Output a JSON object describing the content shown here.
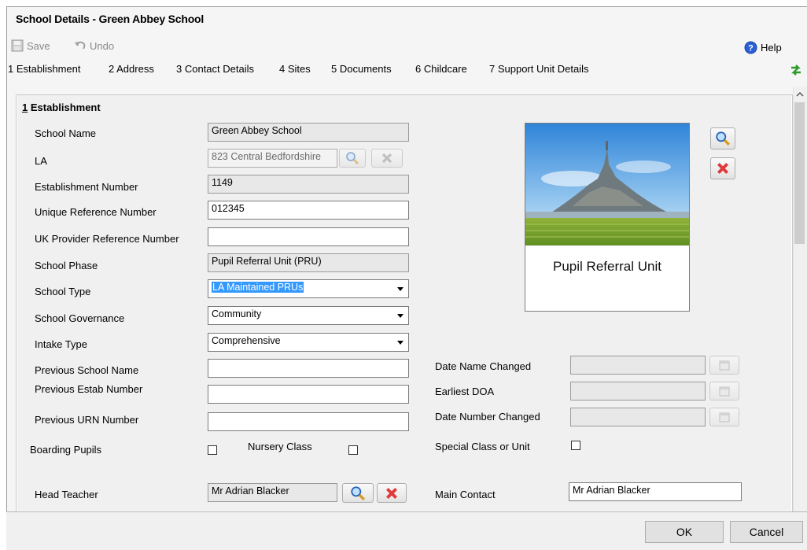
{
  "window": {
    "title": "School Details - Green Abbey School"
  },
  "toolbar": {
    "save_label": "Save",
    "undo_label": "Undo",
    "help_label": "Help"
  },
  "tabs": [
    {
      "label": "1 Establishment"
    },
    {
      "label": "2 Address"
    },
    {
      "label": "3 Contact Details"
    },
    {
      "label": "4 Sites"
    },
    {
      "label": "5 Documents"
    },
    {
      "label": "6 Childcare"
    },
    {
      "label": "7 Support Unit Details"
    }
  ],
  "section": {
    "title": "1 Establishment"
  },
  "fields": {
    "school_name": {
      "label": "School Name",
      "value": "Green Abbey School"
    },
    "la": {
      "label": "LA",
      "value": "823 Central Bedfordshire"
    },
    "establishment_number": {
      "label": "Establishment Number",
      "value": "1149"
    },
    "urn": {
      "label": "Unique Reference Number",
      "value": "012345"
    },
    "ukprn": {
      "label": "UK Provider Reference Number",
      "value": ""
    },
    "school_phase": {
      "label": "School Phase",
      "value": "Pupil Referral Unit (PRU)"
    },
    "school_type": {
      "label": "School Type",
      "value": "LA Maintained PRUs"
    },
    "school_governance": {
      "label": "School Governance",
      "value": "Community"
    },
    "intake_type": {
      "label": "Intake Type",
      "value": "Comprehensive"
    },
    "previous_school_name": {
      "label": "Previous School Name",
      "value": ""
    },
    "previous_estab_number": {
      "label": "Previous Estab Number",
      "value": ""
    },
    "previous_urn": {
      "label": "Previous URN Number",
      "value": ""
    },
    "date_name_changed": {
      "label": "Date Name Changed",
      "value": ""
    },
    "earliest_doa": {
      "label": "Earliest DOA",
      "value": ""
    },
    "date_number_changed": {
      "label": "Date Number Changed",
      "value": ""
    },
    "boarding_pupils": {
      "label": "Boarding Pupils",
      "checked": false
    },
    "nursery_class": {
      "label": "Nursery Class",
      "checked": false
    },
    "special_class": {
      "label": "Special Class or Unit",
      "checked": false
    },
    "head_teacher": {
      "label": "Head Teacher",
      "value": "Mr Adrian Blacker"
    },
    "main_contact": {
      "label": "Main Contact",
      "value": "Mr Adrian Blacker"
    }
  },
  "photo": {
    "caption": "Pupil Referral Unit"
  },
  "footer": {
    "ok_label": "OK",
    "cancel_label": "Cancel"
  },
  "icons": {
    "search": "magnifier-icon",
    "clear": "red-x-icon",
    "calendar": "calendar-icon",
    "refresh": "green-arrows-icon"
  },
  "colors": {
    "selection": "#3399ff",
    "help_blue": "#2a5fd6",
    "clear_red": "#e03a3a"
  }
}
